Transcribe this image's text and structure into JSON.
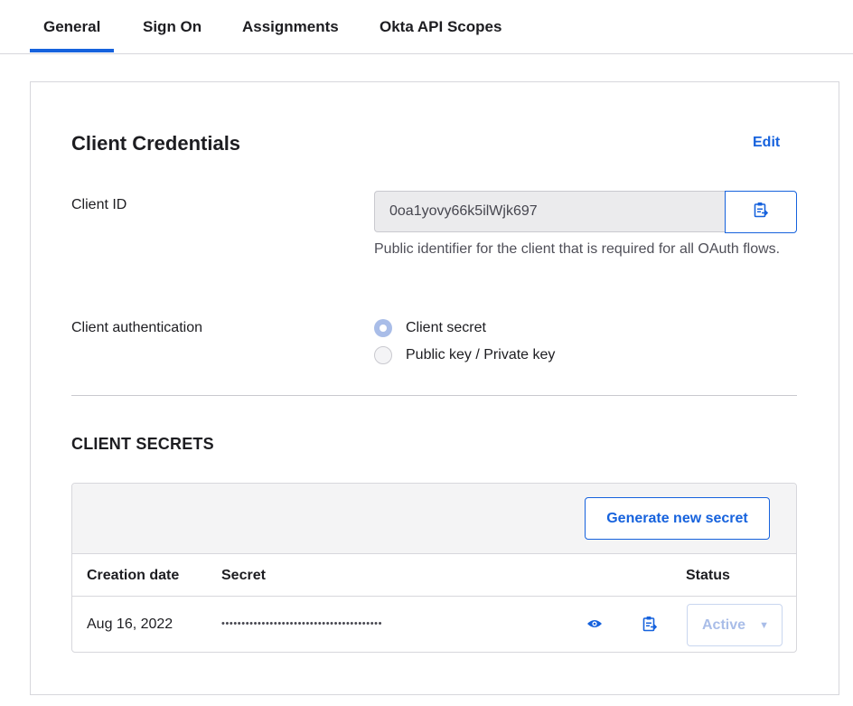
{
  "tabs": [
    {
      "label": "General",
      "active": true
    },
    {
      "label": "Sign On",
      "active": false
    },
    {
      "label": "Assignments",
      "active": false
    },
    {
      "label": "Okta API Scopes",
      "active": false
    }
  ],
  "credentials": {
    "title": "Client Credentials",
    "edit_label": "Edit",
    "client_id_label": "Client ID",
    "client_id_value": "0oa1yovy66k5ilWjk697",
    "client_id_help": "Public identifier for the client that is required for all OAuth flows.",
    "auth_label": "Client authentication",
    "auth_options": [
      {
        "label": "Client secret",
        "selected": true
      },
      {
        "label": "Public key / Private key",
        "selected": false
      }
    ]
  },
  "secrets": {
    "title": "CLIENT SECRETS",
    "generate_label": "Generate new secret",
    "columns": [
      "Creation date",
      "Secret",
      "Status"
    ],
    "rows": [
      {
        "created": "Aug 16, 2022",
        "secret": "••••••••••••••••••••••••••••••••••••••••",
        "status": "Active"
      }
    ]
  },
  "icons": {
    "copy": "clipboard-icon",
    "reveal": "eye-icon",
    "caret": "caret-down-icon"
  },
  "colors": {
    "accent": "#1662dd",
    "disabled_accent": "#a9bde8",
    "input_bg": "#ebebed"
  }
}
